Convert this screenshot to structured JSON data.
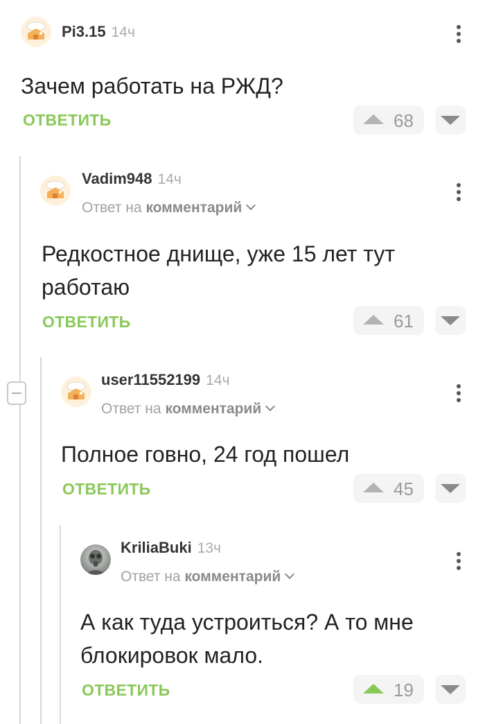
{
  "comments": [
    {
      "username": "Pi3.15",
      "time": "14ч",
      "text": "Зачем работать на РЖД?",
      "reply_label": "ОТВЕТИТЬ",
      "votes": "68",
      "upvoted": false,
      "avatar": "pikabu-house-avatar"
    },
    {
      "username": "Vadim948",
      "time": "14ч",
      "reply_to_prefix": "Ответ на",
      "reply_to_target": "комментарий",
      "text": "Редкостное днище, уже 15 лет тут работаю",
      "reply_label": "ОТВЕТИТЬ",
      "votes": "61",
      "upvoted": false,
      "avatar": "pikabu-house-avatar"
    },
    {
      "username": "user11552199",
      "time": "14ч",
      "reply_to_prefix": "Ответ на",
      "reply_to_target": "комментарий",
      "text": "Полное говно, 24 год пошел",
      "reply_label": "ОТВЕТИТЬ",
      "votes": "45",
      "upvoted": false,
      "avatar": "pikabu-house-avatar"
    },
    {
      "username": "KriliaBuki",
      "time": "13ч",
      "reply_to_prefix": "Ответ на",
      "reply_to_target": "комментарий",
      "text": "А как туда устроиться? А то мне блокировок мало.",
      "reply_label": "ОТВЕТИТЬ",
      "votes": "19",
      "upvoted": true,
      "avatar": "gas-mask-photo-avatar"
    }
  ],
  "colors": {
    "accent_green": "#8ac858",
    "muted_gray": "#9a9a9a",
    "vote_bg": "#f4f4f4"
  }
}
